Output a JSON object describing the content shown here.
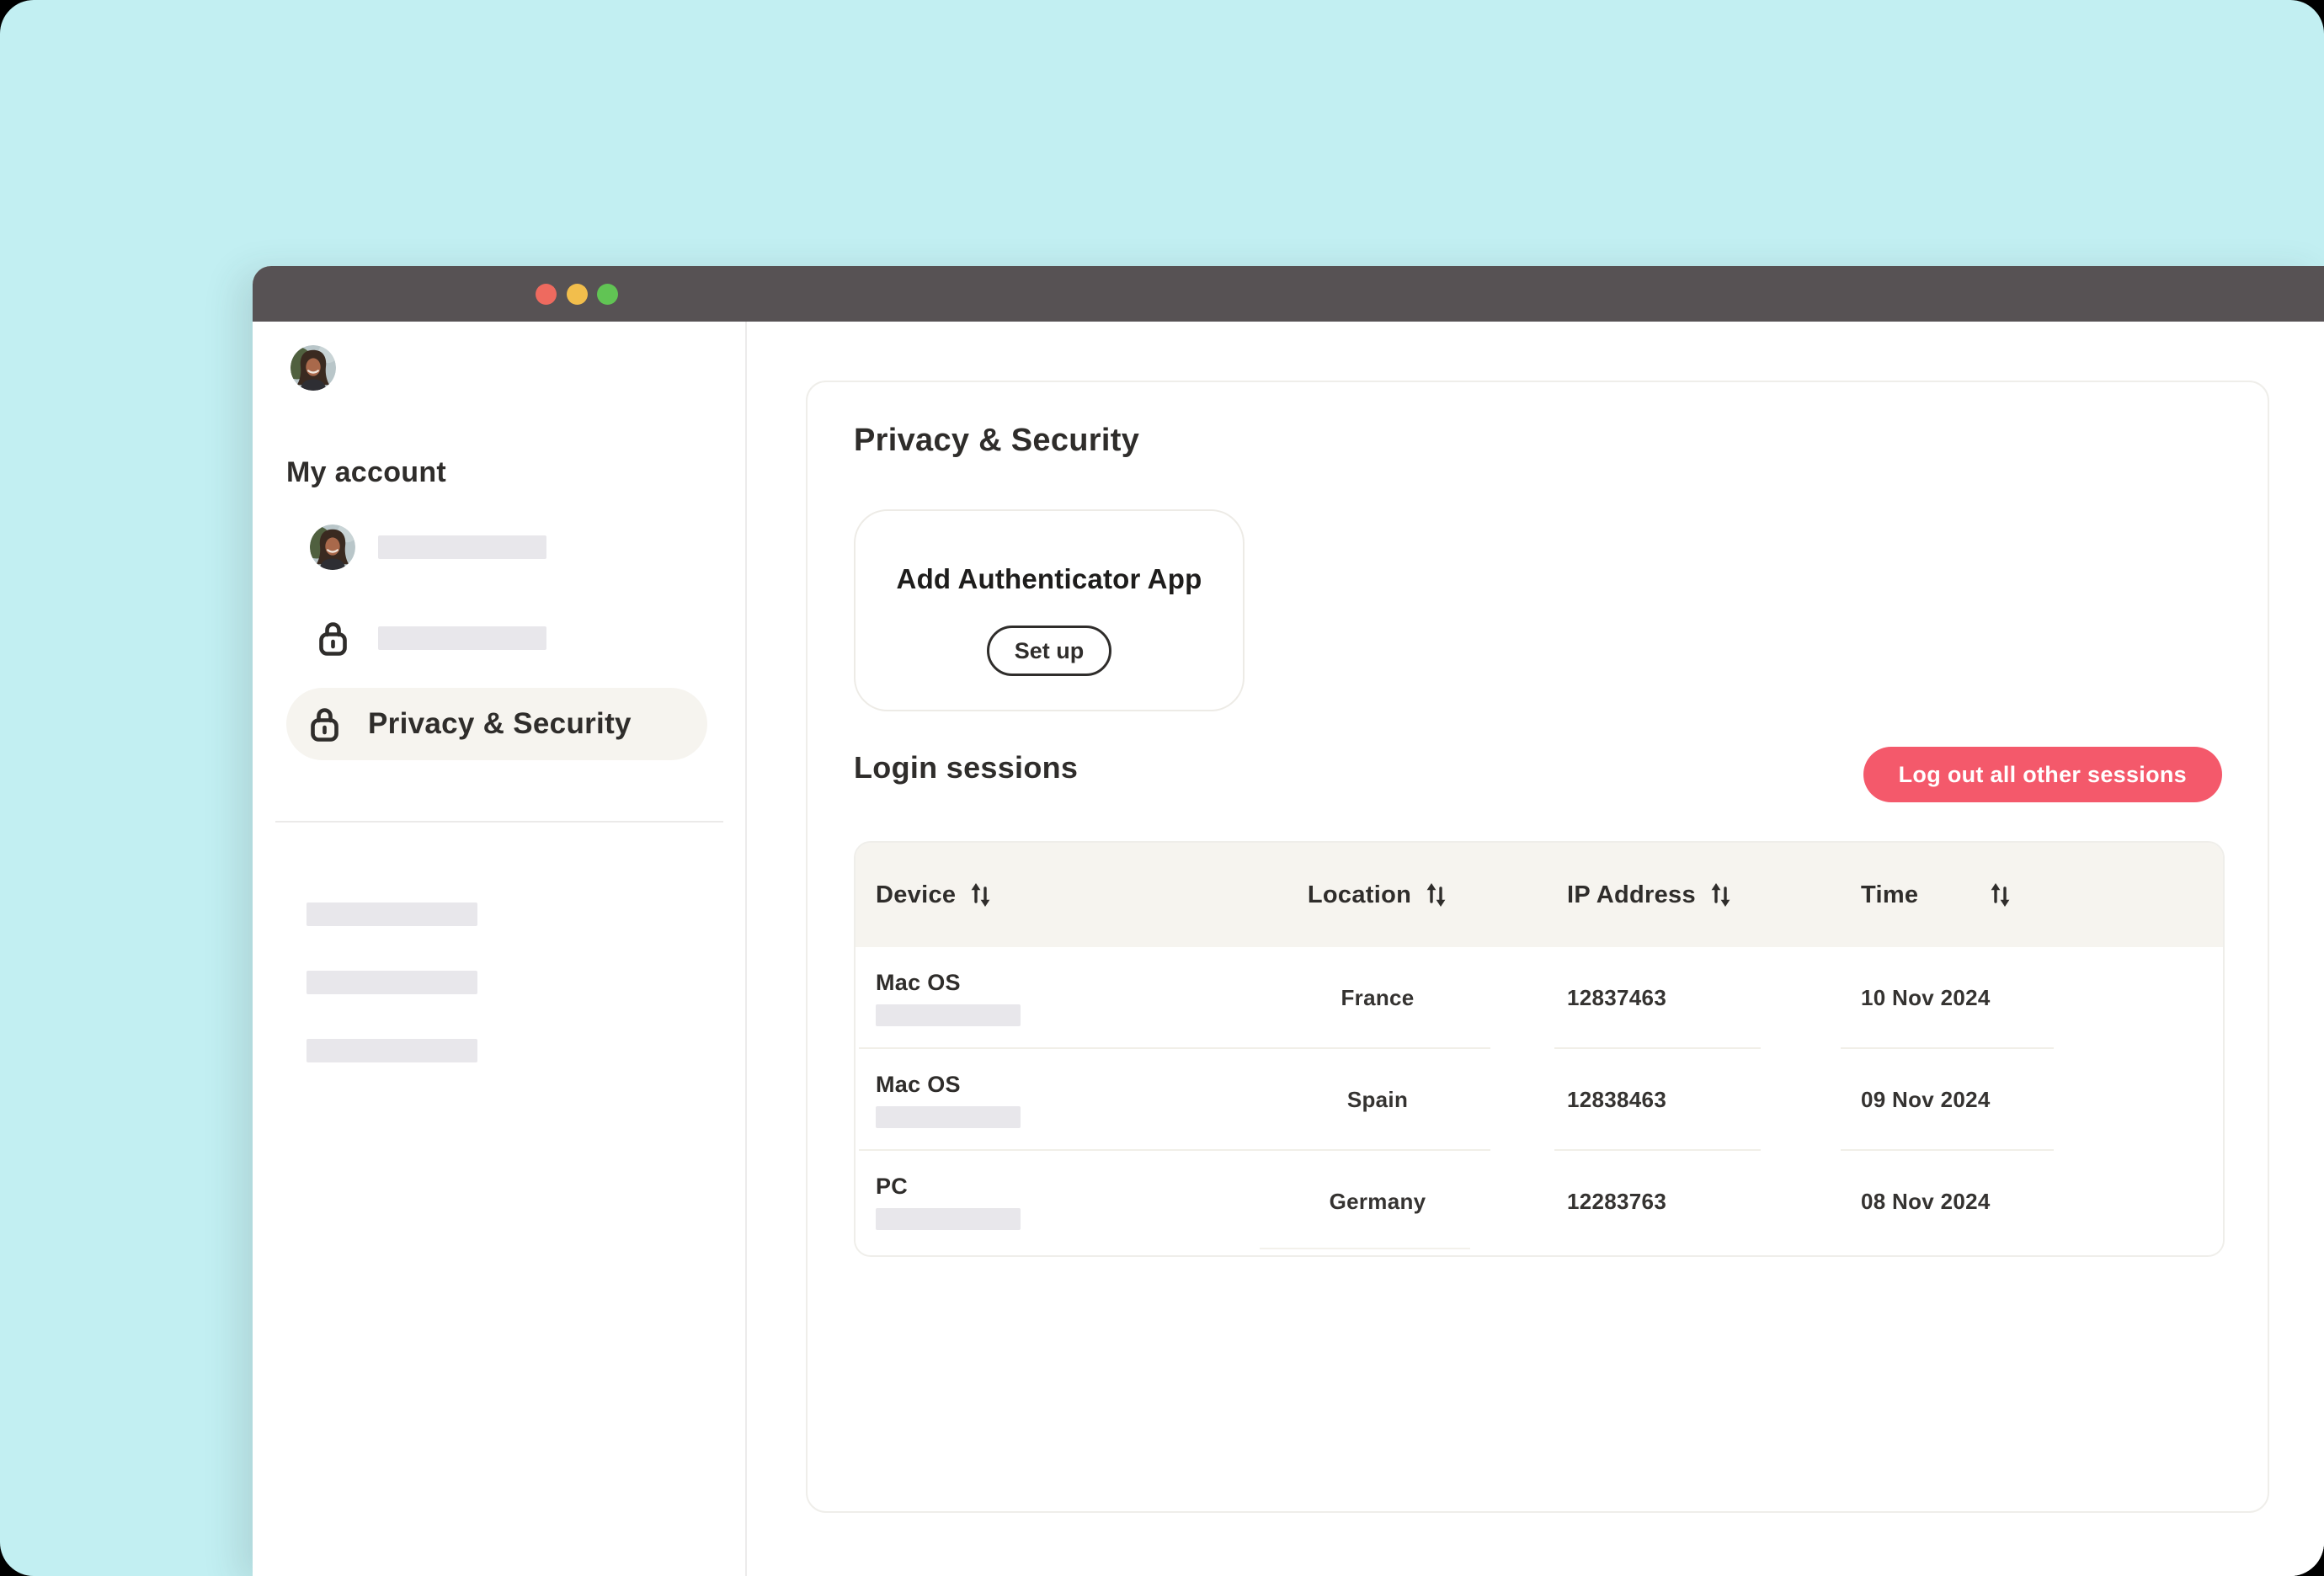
{
  "window": {
    "controls": {
      "close": "close",
      "minimize": "minimize",
      "zoom": "zoom"
    }
  },
  "sidebar": {
    "section_title": "My account",
    "items": [
      {
        "icon": "avatar",
        "label_placeholder": true
      },
      {
        "icon": "lock",
        "label_placeholder": true
      },
      {
        "icon": "lock",
        "label": "Privacy & Security",
        "active": true
      }
    ]
  },
  "main": {
    "title": "Privacy & Security",
    "authenticator_card": {
      "title": "Add Authenticator App",
      "button_label": "Set up"
    },
    "sessions": {
      "title": "Login sessions",
      "logout_button_label": "Log out all other sessions",
      "table": {
        "columns": [
          "Device",
          "Location",
          "IP Address",
          "Time"
        ],
        "rows": [
          {
            "device": "Mac OS",
            "location": "France",
            "ip": "12837463",
            "time": "10 Nov 2024"
          },
          {
            "device": "Mac OS",
            "location": "Spain",
            "ip": "12838463",
            "time": "09 Nov 2024"
          },
          {
            "device": "PC",
            "location": "Germany",
            "ip": "12283763",
            "time": "08 Nov 2024"
          }
        ]
      }
    }
  },
  "colors": {
    "background": "#C2EFF2",
    "titlebar": "#575254",
    "accent_red": "#F4596B",
    "cream": "#F6F4EF",
    "text_dark": "#2F2D2B",
    "skeleton": "#E8E7EB",
    "traffic_red": "#EE6A5F",
    "traffic_yellow": "#F2BE4C",
    "traffic_green": "#61C454"
  }
}
